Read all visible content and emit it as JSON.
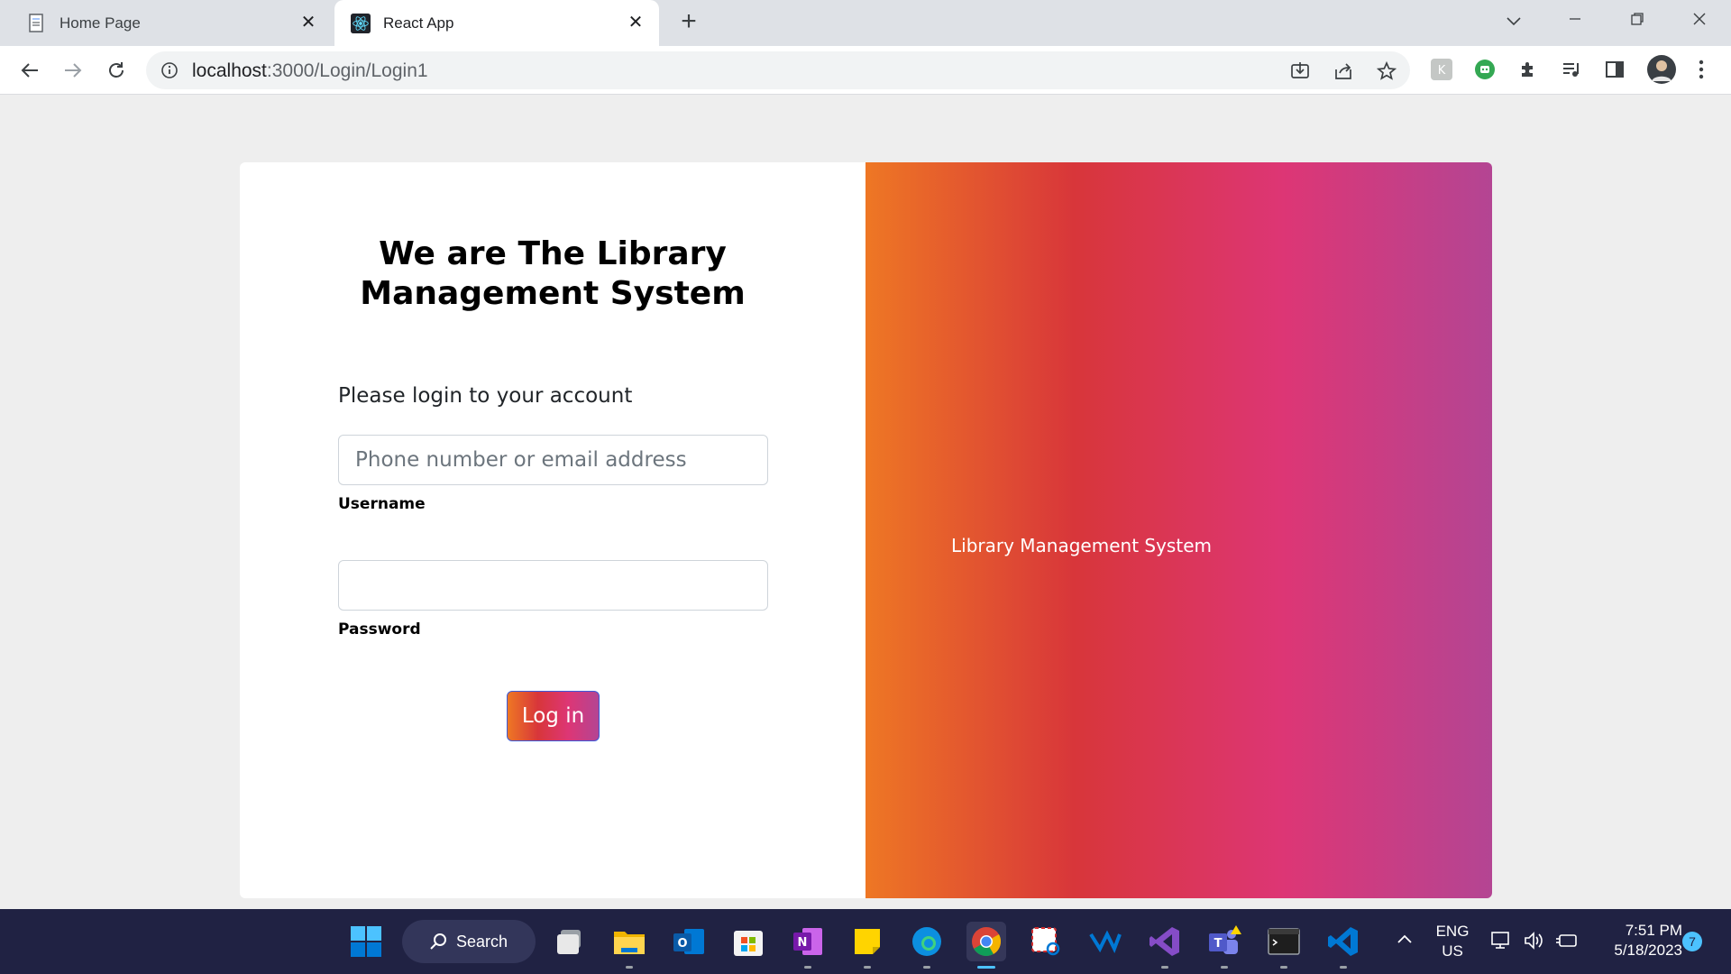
{
  "browser": {
    "tabs": [
      {
        "title": "Home Page",
        "active": false
      },
      {
        "title": "React App",
        "active": true
      }
    ],
    "url_host": "localhost",
    "url_path": ":3000/Login/Login1"
  },
  "page": {
    "heading_line1": "We are The Library",
    "heading_line2": "Management System",
    "subtext": "Please login to your account",
    "username_placeholder": "Phone number or email address",
    "username_value": "",
    "username_label": "Username",
    "password_value": "",
    "password_label": "Password",
    "login_button": "Log in",
    "right_panel_text": "Library Management System",
    "gradient_colors": [
      "#ee7724",
      "#d8363a",
      "#dd3675",
      "#b44593"
    ]
  },
  "taskbar": {
    "search_label": "Search",
    "language_line1": "ENG",
    "language_line2": "US",
    "time": "7:51 PM",
    "date": "5/18/2023",
    "notification_count": "7"
  }
}
